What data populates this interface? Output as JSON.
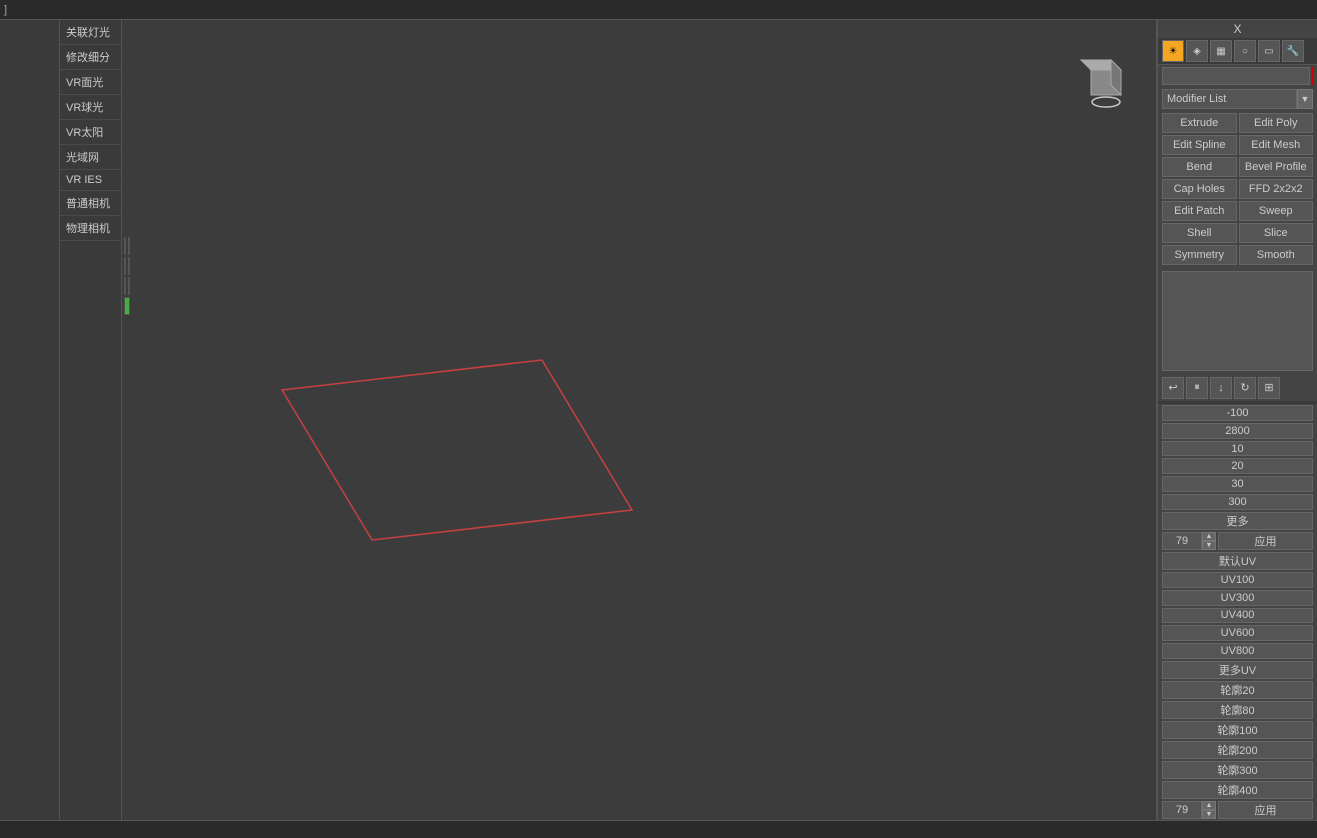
{
  "topbar": {
    "label": "] "
  },
  "viewport": {
    "label": ""
  },
  "sidebar": {
    "items": [
      {
        "label": "关联灯光"
      },
      {
        "label": "修改细分"
      },
      {
        "label": "VR面光"
      },
      {
        "label": "VR球光"
      },
      {
        "label": "VR太阳"
      },
      {
        "label": "光域网"
      },
      {
        "label": "VR IES"
      },
      {
        "label": "普通相机"
      },
      {
        "label": "物理相机"
      }
    ]
  },
  "panel": {
    "x_label": "X",
    "modifier_list_label": "Modifier List",
    "buttons": [
      {
        "label": "Extrude"
      },
      {
        "label": "Edit Poly"
      },
      {
        "label": "Edit Spline"
      },
      {
        "label": "Edit Mesh"
      },
      {
        "label": "Bend"
      },
      {
        "label": "Bevel Profile"
      },
      {
        "label": "Cap Holes"
      },
      {
        "label": "FFD 2x2x2"
      },
      {
        "label": "Edit Patch"
      },
      {
        "label": "Sweep"
      },
      {
        "label": "Shell"
      },
      {
        "label": "Slice"
      },
      {
        "label": "Symmetry"
      },
      {
        "label": "Smooth"
      }
    ],
    "swatches": [
      {
        "color": "#c8a040"
      },
      {
        "color": "#b88030"
      },
      {
        "color": "#c8a840"
      },
      {
        "color": "#b89840"
      },
      {
        "color": "#a0b8e0"
      },
      {
        "color": "#80a0d0"
      },
      {
        "color": "#40b040"
      }
    ],
    "apply_label": "应用",
    "numbers": [
      {
        "label": "-100"
      },
      {
        "label": "2800"
      },
      {
        "label": "10"
      },
      {
        "label": "20"
      },
      {
        "label": "30"
      },
      {
        "label": "300"
      },
      {
        "label": "更多"
      }
    ],
    "spinner_value": "79",
    "apply2_label": "应用",
    "uv_items": [
      {
        "label": "默认UV"
      },
      {
        "label": "UV100"
      },
      {
        "label": "UV300"
      },
      {
        "label": "UV400"
      },
      {
        "label": "UV600"
      },
      {
        "label": "UV800"
      },
      {
        "label": "更多UV"
      },
      {
        "label": "轮廓20"
      },
      {
        "label": "轮廓80"
      },
      {
        "label": "轮廓100"
      },
      {
        "label": "轮廓200"
      },
      {
        "label": "轮廓300"
      },
      {
        "label": "轮廓400"
      }
    ],
    "spinner2_value": "79",
    "apply3_label": "应用"
  },
  "icons": {
    "toolbar": [
      {
        "name": "sun-icon",
        "symbol": "☀"
      },
      {
        "name": "modifier-icon",
        "symbol": "◈"
      },
      {
        "name": "grid-icon",
        "symbol": "▦"
      },
      {
        "name": "sphere-icon",
        "symbol": "○"
      },
      {
        "name": "display-icon",
        "symbol": "▭"
      },
      {
        "name": "wrench-icon",
        "symbol": "🔧"
      }
    ],
    "preview": [
      {
        "name": "back-icon",
        "symbol": "↩"
      },
      {
        "name": "pause-icon",
        "symbol": "⏸"
      },
      {
        "name": "down-icon",
        "symbol": "↓"
      },
      {
        "name": "refresh-icon",
        "symbol": "↻"
      },
      {
        "name": "export-icon",
        "symbol": "⊞"
      }
    ]
  },
  "statusbar": {
    "text": ""
  }
}
